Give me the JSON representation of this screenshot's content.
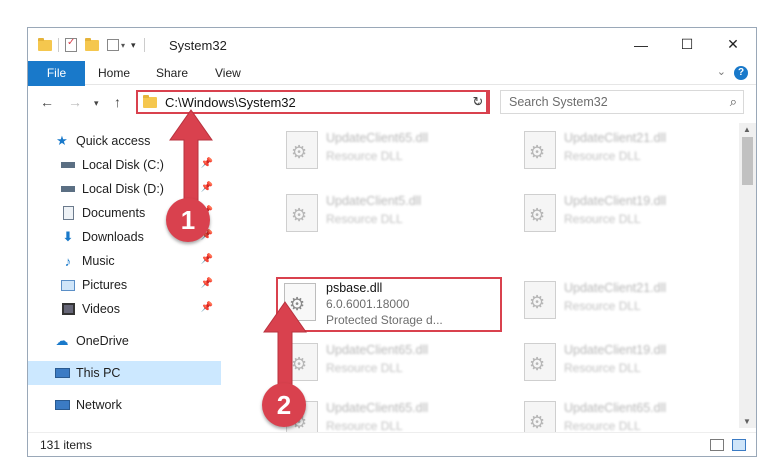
{
  "window": {
    "title": "System32",
    "controls": {
      "minimize": "—",
      "maximize": "☐",
      "close": "✕"
    }
  },
  "ribbon": {
    "tabs": [
      "File",
      "Home",
      "Share",
      "View"
    ],
    "help": "?"
  },
  "address_bar": {
    "path": "C:\\Windows\\System32",
    "refresh_icon": "↻"
  },
  "search": {
    "placeholder": "Search System32"
  },
  "sidebar": {
    "items": [
      {
        "label": "Quick access",
        "icon": "star-icon",
        "pinned": false
      },
      {
        "label": "Local Disk (C:)",
        "icon": "drive-icon",
        "pinned": true
      },
      {
        "label": "Local Disk (D:)",
        "icon": "drive-icon",
        "pinned": true
      },
      {
        "label": "Documents",
        "icon": "documents-icon",
        "pinned": true
      },
      {
        "label": "Downloads",
        "icon": "download-icon",
        "pinned": true
      },
      {
        "label": "Music",
        "icon": "music-icon",
        "pinned": true
      },
      {
        "label": "Pictures",
        "icon": "pictures-icon",
        "pinned": true
      },
      {
        "label": "Videos",
        "icon": "videos-icon",
        "pinned": true
      },
      {
        "label": "OneDrive",
        "icon": "cloud-icon",
        "pinned": false
      },
      {
        "label": "This PC",
        "icon": "computer-icon",
        "pinned": false,
        "selected": true
      },
      {
        "label": "Network",
        "icon": "network-icon",
        "pinned": false
      }
    ]
  },
  "files": [
    {
      "name": "UpdateClient65.dll",
      "type": "Resource DLL"
    },
    {
      "name": "UpdateClient21.dll",
      "type": "Resource DLL"
    },
    {
      "name": "UpdateClient5.dll",
      "type": "Resource DLL"
    },
    {
      "name": "UpdateClient19.dll",
      "type": "Resource DLL"
    },
    {
      "name": "psbase.dll",
      "version": "6.0.6001.18000",
      "description": "Protected Storage d...",
      "highlighted": true
    },
    {
      "name": "UpdateClient21.dll",
      "type": "Resource DLL"
    },
    {
      "name": "UpdateClient65.dll",
      "type": "Resource DLL"
    },
    {
      "name": "UpdateClient19.dll",
      "type": "Resource DLL"
    },
    {
      "name": "UpdateClient65.dll",
      "type": "Resource DLL"
    },
    {
      "name": "UpdateClient65.dll",
      "type": "Resource DLL"
    }
  ],
  "status_bar": {
    "item_count": "131 items"
  },
  "annotations": {
    "step1": "1",
    "step2": "2"
  },
  "colors": {
    "accent": "#1979ca",
    "highlight": "#d9414e",
    "selection": "#cce8ff"
  }
}
